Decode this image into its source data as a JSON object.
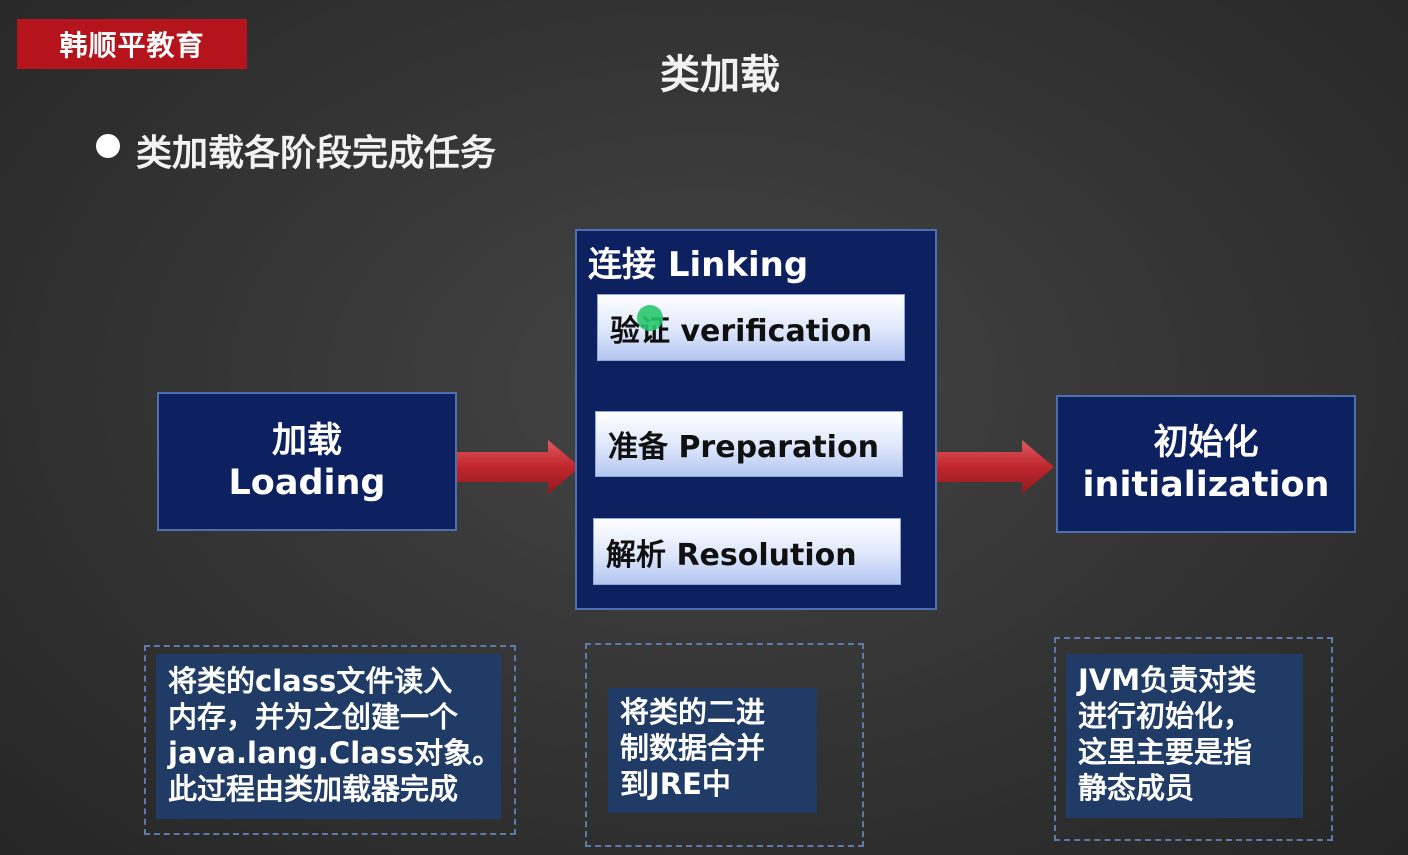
{
  "brand": "韩顺平教育",
  "title": "类加载",
  "bullet": "类加载各阶段完成任务",
  "stages": {
    "loading": {
      "zh": "加载",
      "en": "Loading"
    },
    "linking": {
      "title": "连接 Linking",
      "steps": [
        "验证 verification",
        "准备 Preparation",
        "解析 Resolution"
      ]
    },
    "initialization": {
      "zh": "初始化",
      "en": "initialization"
    }
  },
  "descriptions": {
    "loading": [
      "将类的class文件读入",
      "内存，并为之创建一个",
      "java.lang.Class对象。",
      "此过程由类加载器完成"
    ],
    "linking": [
      "将类的二进",
      "制数据合并",
      "到JRE中"
    ],
    "initialization": [
      "JVM负责对类",
      "进行初始化，",
      "这里主要是指",
      "静态成员"
    ]
  },
  "colors": {
    "brand_red": "#b5141d",
    "stage_navy": "#0d2060",
    "arrow_red": "#c0262d",
    "desc_blue": "#1f3b66"
  }
}
